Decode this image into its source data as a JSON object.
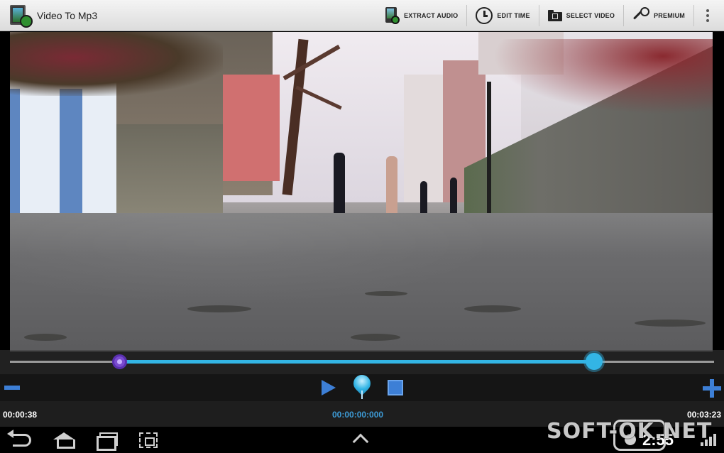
{
  "app": {
    "title": "Video To Mp3",
    "icon": "video-to-mp3-app-icon"
  },
  "actions": [
    {
      "label": "EXTRACT AUDIO",
      "icon": "extract-audio-icon"
    },
    {
      "label": "EDIT TIME",
      "icon": "clock-icon"
    },
    {
      "label": "SELECT VIDEO",
      "icon": "folder-icon"
    },
    {
      "label": "PREMIUM",
      "icon": "key-icon"
    }
  ],
  "overflow_icon": "overflow-menu-icon",
  "player": {
    "range_start_fraction": 0.155,
    "range_end_fraction": 0.83,
    "time_start": "00:00:38",
    "time_current": "00:00:00:000",
    "time_end": "00:03:23",
    "accent": "#33b5e5",
    "button_color": "#3d7fd6"
  },
  "statusbar": {
    "clock": "2:55"
  },
  "watermark": {
    "text": "SOFT-OK.NET"
  }
}
